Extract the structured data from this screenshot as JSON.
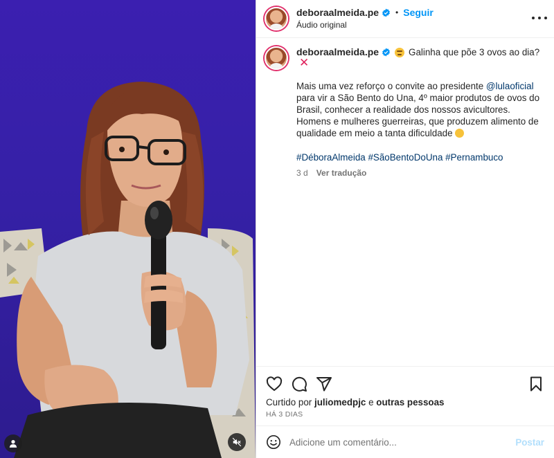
{
  "post": {
    "username": "deboraalmeida.pe",
    "follow_label": "Seguir",
    "separator": "•",
    "audio_label": "Áudio original",
    "caption": {
      "title": "Galinha que põe 3 ovos ao dia?",
      "title_prefix_emoji": "thinking-face-icon",
      "title_suffix_emoji": "cross-mark-icon",
      "text_before_mention": "Mais uma vez reforço o convite ao presidente ",
      "mention": "@lulaoficial",
      "text_after_mention": " para vir a São Bento do Una, 4º maior produtos de ovos do Brasil, conhecer a realidade dos nossos avicultores. Homens e mulheres guerreiras, que produzem alimento de qualidade em meio a tanta dificuldade",
      "suffix_emoji": "winking-face-icon",
      "hashtags": "#DéboraAlmeida #SãoBentoDoUna #Pernambuco",
      "age": "3 d",
      "translate_label": "Ver tradução"
    },
    "likes": {
      "prefix": "Curtido por ",
      "user": "juliomedpjc",
      "middle": " e ",
      "others": "outras pessoas"
    },
    "timestamp": "HÁ 3 DIAS",
    "comment": {
      "placeholder": "Adicione um comentário...",
      "post_label": "Postar"
    }
  },
  "icons": {
    "like": "heart-icon",
    "comment": "comment-icon",
    "share": "send-icon",
    "save": "bookmark-icon",
    "more": "more-options-icon",
    "verified": "verified-badge-icon",
    "emoji": "emoji-smile-icon",
    "user_tag": "user-tag-icon",
    "mute": "muted-speaker-icon"
  },
  "colors": {
    "accent": "#0095f6",
    "link": "#00376b",
    "muted_text": "#737373",
    "post_disabled": "#b2dffc",
    "video_background": "#3520a6"
  }
}
